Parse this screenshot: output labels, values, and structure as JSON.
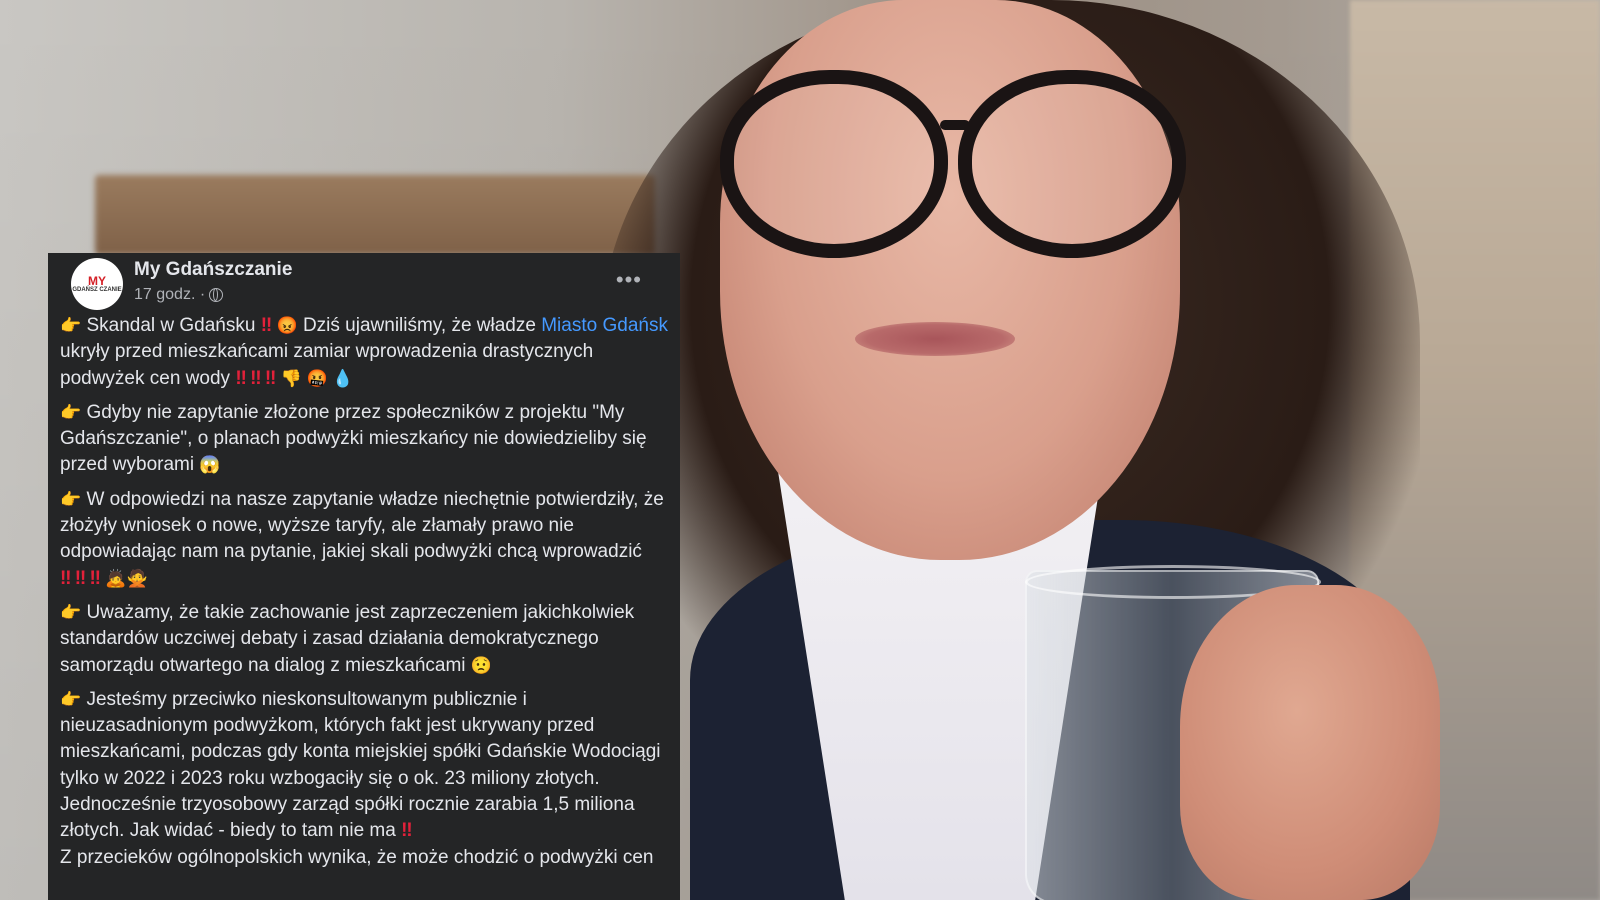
{
  "post": {
    "author": "My Gdańszczanie",
    "avatar_text": "MY",
    "avatar_sub": "GDAŃSZ CZANIE",
    "timestamp": "17 godz. ·",
    "more_glyph": "•••",
    "pointer_glyph": "👉",
    "p1": {
      "lead": "Skandal w Gdańsku",
      "e1": "‼",
      "e2": "😡",
      "mid": "Dziś ujawniliśmy, że władze",
      "link": "Miasto Gdańsk",
      "rest": "ukryły przed mieszkańcami zamiar wprowadzenia drastycznych podwyżek cen wody",
      "tail_red": "‼ ‼ ‼",
      "tail_emoji": "👎 🤬 💧"
    },
    "p2": {
      "text": "Gdyby nie zapytanie złożone przez społeczników z projektu \"My Gdańszczanie\", o planach podwyżki mieszkańcy nie dowiedzieliby się przed wyborami",
      "emoji": "😱"
    },
    "p3": {
      "text": "W odpowiedzi na nasze zapytanie władze niechętnie potwierdziły, że złożyły wniosek o nowe, wyższe taryfy, ale złamały prawo nie odpowiadając nam na pytanie, jakiej skali podwyżki chcą wprowadzić",
      "tail_red": "‼ ‼ ‼",
      "tail_emoji": "🙇🙅"
    },
    "p4": {
      "text": "Uważamy, że takie zachowanie jest zaprzeczeniem jakichkolwiek standardów uczciwej debaty i zasad działania demokratycznego samorządu otwartego na dialog z mieszkańcami",
      "emoji": "😟"
    },
    "p5": {
      "text": "Jesteśmy przeciwko nieskonsultowanym publicznie i nieuzasadnionym podwyżkom, których fakt jest ukrywany przed mieszkańcami, podczas gdy konta miejskiej spółki Gdańskie Wodociągi tylko w 2022 i 2023 roku wzbogaciły się o ok. 23 miliony złotych. Jednocześnie trzyosobowy zarząd spółki rocznie zarabia 1,5 miliona złotych. Jak widać - biedy to tam nie ma",
      "tail_red": "‼",
      "cont": "Z przecieków ogólnopolskich wynika, że może chodzić o podwyżki cen"
    }
  },
  "colors": {
    "card_bg": "#242526",
    "text": "#e4e6eb",
    "muted": "#b0b3b8",
    "link": "#4599ff",
    "alert": "#e2213a"
  }
}
